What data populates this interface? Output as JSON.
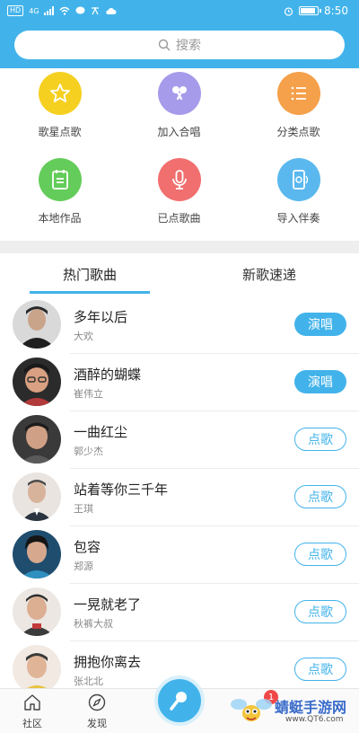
{
  "status_bar": {
    "sim": "HD",
    "network": "4G",
    "time": "8:50"
  },
  "search": {
    "placeholder": "搜索"
  },
  "shortcuts": [
    {
      "label": "歌星点歌",
      "icon": "star-icon",
      "color": "#f5d020"
    },
    {
      "label": "加入合唱",
      "icon": "duet-mic-icon",
      "color": "#a69bea"
    },
    {
      "label": "分类点歌",
      "icon": "list-icon",
      "color": "#f5a04a"
    },
    {
      "label": "本地作品",
      "icon": "calendar-doc-icon",
      "color": "#64cc5a"
    },
    {
      "label": "已点歌曲",
      "icon": "microphone-icon",
      "color": "#f16f6f"
    },
    {
      "label": "导入伴奏",
      "icon": "phone-import-icon",
      "color": "#5ab8ee"
    }
  ],
  "tabs": [
    {
      "label": "热门歌曲",
      "active": true
    },
    {
      "label": "新歌速递",
      "active": false
    }
  ],
  "songs": [
    {
      "title": "多年以后",
      "artist": "大欢",
      "action": "演唱",
      "style": "solid"
    },
    {
      "title": "酒醉的蝴蝶",
      "artist": "崔伟立",
      "action": "演唱",
      "style": "solid"
    },
    {
      "title": "一曲红尘",
      "artist": "郭少杰",
      "action": "点歌",
      "style": "outline"
    },
    {
      "title": "站着等你三千年",
      "artist": "王琪",
      "action": "点歌",
      "style": "outline"
    },
    {
      "title": "包容",
      "artist": "郑源",
      "action": "点歌",
      "style": "outline"
    },
    {
      "title": "一晃就老了",
      "artist": "秋裤大叔",
      "action": "点歌",
      "style": "outline"
    },
    {
      "title": "拥抱你离去",
      "artist": "张北北",
      "action": "点歌",
      "style": "outline"
    }
  ],
  "bottom_nav": {
    "community": "社区",
    "discover": "发现",
    "badge_count": "1"
  },
  "watermark": {
    "name": "蜻蜓手游网",
    "url": "www.QT6.com"
  },
  "colors": {
    "accent": "#42b3ea"
  }
}
